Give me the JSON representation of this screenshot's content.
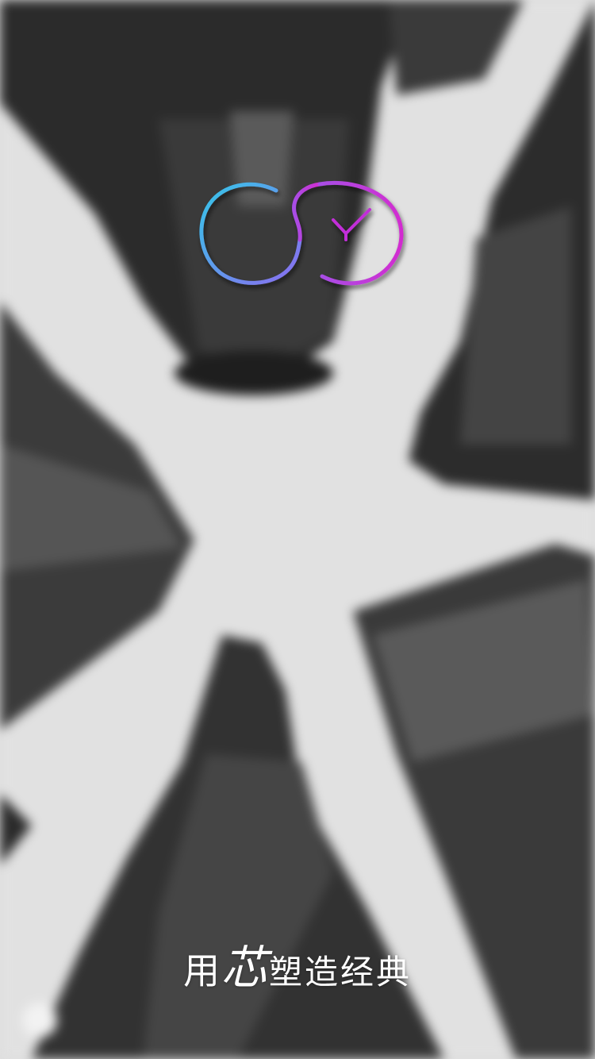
{
  "screen": "splash",
  "background": {
    "description_icon": "skyscrapers-photo",
    "tone": "grayscale-blurred"
  },
  "logo": {
    "icon": "infinity-clock-logo-icon",
    "colors": {
      "left_start": "#35c6e8",
      "left_end": "#8b6cf0",
      "right": "#c22fd8"
    }
  },
  "slogan": {
    "part1": "用",
    "part2": "芯",
    "part3": "塑造经典"
  }
}
